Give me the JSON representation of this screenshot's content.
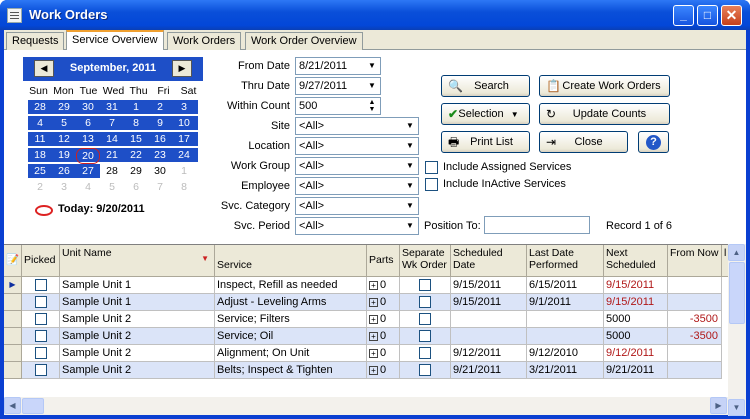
{
  "window": {
    "title": "Work Orders",
    "minimize": "_",
    "maximize": "□",
    "close": "✕"
  },
  "tabs": [
    "Requests",
    "Service Overview",
    "Work Orders",
    "Work Order Overview"
  ],
  "calendar": {
    "prev": "◀",
    "next": "▶",
    "month_label": "September, 2011",
    "dow": [
      "Sun",
      "Mon",
      "Tue",
      "Wed",
      "Thu",
      "Fri",
      "Sat"
    ],
    "weeks": [
      [
        "28",
        "29",
        "30",
        "31",
        "1",
        "2",
        "3"
      ],
      [
        "4",
        "5",
        "6",
        "7",
        "8",
        "9",
        "10"
      ],
      [
        "11",
        "12",
        "13",
        "14",
        "15",
        "16",
        "17"
      ],
      [
        "18",
        "19",
        "20",
        "21",
        "22",
        "23",
        "24"
      ],
      [
        "25",
        "26",
        "27",
        "28",
        "29",
        "30",
        "1"
      ],
      [
        "2",
        "3",
        "4",
        "5",
        "6",
        "7",
        "8"
      ]
    ],
    "today_label": "Today: 9/20/2011"
  },
  "filters": {
    "from_date_label": "From Date",
    "from_date": "8/21/2011",
    "thru_date_label": "Thru Date",
    "thru_date": "9/27/2011",
    "within_count_label": "Within Count",
    "within_count": "500",
    "site_label": "Site",
    "site": "<All>",
    "location_label": "Location",
    "location": "<All>",
    "work_group_label": "Work Group",
    "work_group": "<All>",
    "employee_label": "Employee",
    "employee": "<All>",
    "svc_category_label": "Svc. Category",
    "svc_category": "<All>",
    "svc_period_label": "Svc. Period",
    "svc_period": "<All>",
    "position_to_label": "Position To:",
    "position_to": "",
    "record_label": "Record 1 of 6"
  },
  "buttons": {
    "search": "Search",
    "create_work_orders": "Create Work Orders",
    "selection": "Selection",
    "update_counts": "Update Counts",
    "print_list": "Print List",
    "close": "Close",
    "help": "?"
  },
  "checkboxes": {
    "include_assigned": "Include Assigned Services",
    "include_inactive": "Include InActive Services"
  },
  "grid": {
    "headers": {
      "picked": "Picked",
      "unit_name": "Unit Name",
      "service": "Service",
      "parts": "Parts",
      "separate_wk_order": "Separate Wk Order",
      "scheduled_date": "Scheduled Date",
      "last_date_performed": "Last Date Performed",
      "next_scheduled": "Next Scheduled",
      "from_now": "From Now",
      "extra": "l"
    },
    "rows": [
      {
        "unit": "Sample Unit 1",
        "service": "Inspect, Refill as needed",
        "parts": "0",
        "scheduled": "9/15/2011",
        "last": "6/15/2011",
        "next": "9/15/2011",
        "from_now": ""
      },
      {
        "unit": "Sample Unit 1",
        "service": "Adjust - Leveling Arms",
        "parts": "0",
        "scheduled": "9/15/2011",
        "last": "9/1/2011",
        "next": "9/15/2011",
        "from_now": ""
      },
      {
        "unit": "Sample Unit 2",
        "service": "Service; Filters",
        "parts": "0",
        "scheduled": "",
        "last": "",
        "next": "5000",
        "from_now": "-3500"
      },
      {
        "unit": "Sample Unit 2",
        "service": "Service; Oil",
        "parts": "0",
        "scheduled": "",
        "last": "",
        "next": "5000",
        "from_now": "-3500"
      },
      {
        "unit": "Sample Unit 2",
        "service": "Alignment; On Unit",
        "parts": "0",
        "scheduled": "9/12/2011",
        "last": "9/12/2010",
        "next": "9/12/2011",
        "from_now": ""
      },
      {
        "unit": "Sample Unit 2",
        "service": "Belts; Inspect & Tighten",
        "parts": "0",
        "scheduled": "9/21/2011",
        "last": "3/21/2011",
        "next": "9/21/2011",
        "from_now": ""
      }
    ]
  },
  "colors": {
    "title_blue": "#0a4fd9",
    "calendar_blue": "#1e4fc7",
    "row_alt": "#dbe4f8",
    "overdue_red": "#b01818"
  }
}
